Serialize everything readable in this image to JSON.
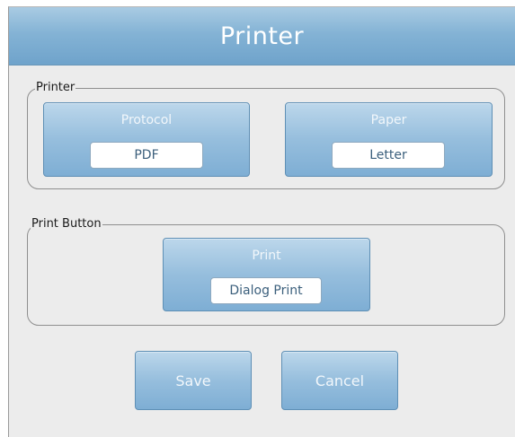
{
  "dialog": {
    "title": "Printer"
  },
  "printer_group": {
    "legend": "Printer",
    "protocol": {
      "label": "Protocol",
      "value": "PDF"
    },
    "paper": {
      "label": "Paper",
      "value": "Letter"
    }
  },
  "print_group": {
    "legend": "Print Button",
    "print": {
      "label": "Print",
      "value": "Dialog Print"
    }
  },
  "actions": {
    "save_label": "Save",
    "cancel_label": "Cancel"
  },
  "colors": {
    "titlebar": "#84b3d5",
    "tile": "#96bedd",
    "background": "#ececec"
  }
}
